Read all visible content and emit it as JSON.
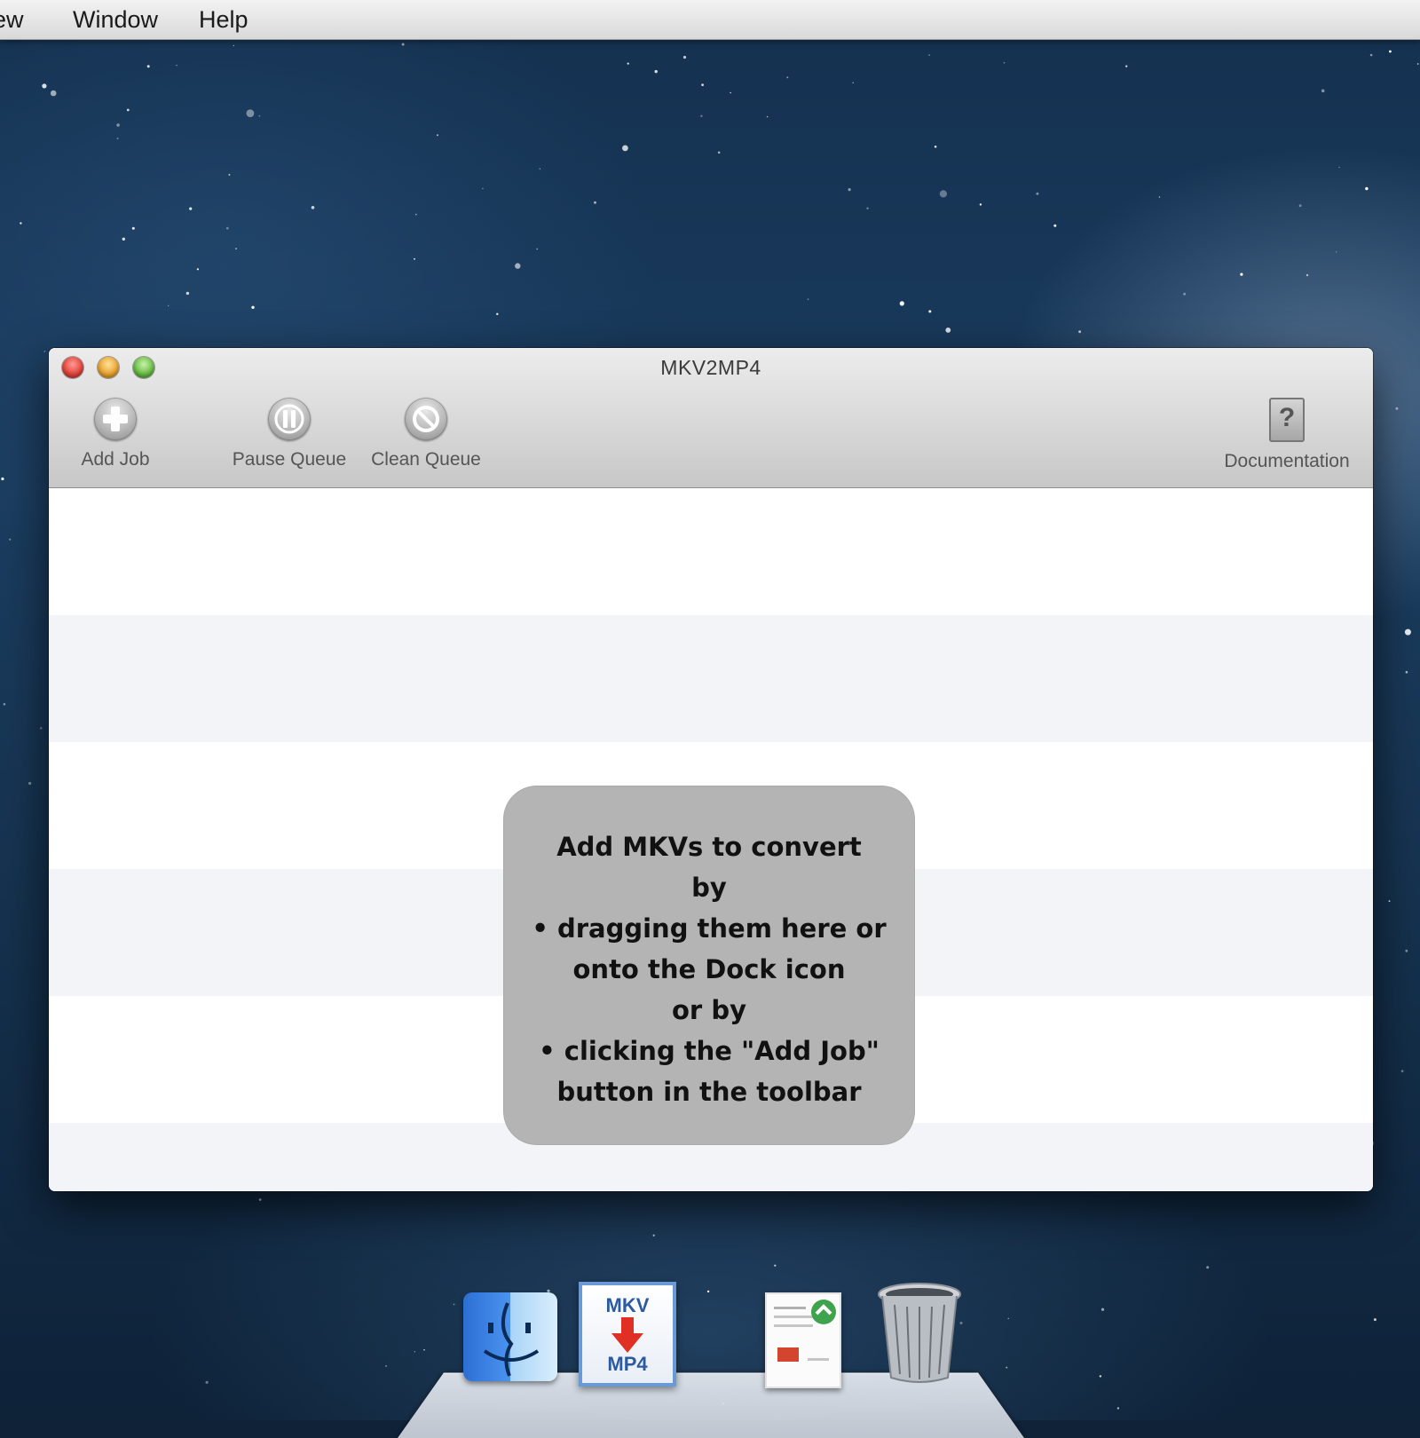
{
  "menubar": {
    "items": [
      "iew",
      "Window",
      "Help"
    ]
  },
  "window": {
    "title": "MKV2MP4",
    "toolbar": {
      "add_job": "Add Job",
      "pause_queue": "Pause Queue",
      "clean_queue": "Clean Queue",
      "documentation": "Documentation"
    },
    "hint": "Add MKVs to convert\nby\n• dragging them here or\nonto the Dock icon\nor by\n• clicking the \"Add Job\"\nbutton in the toolbar"
  },
  "dock": {
    "mkv_icon_top": "MKV",
    "mkv_icon_bottom": "MP4",
    "items": [
      "finder-icon",
      "mkv2mp4-icon",
      "preview-document-icon",
      "trash-icon"
    ]
  },
  "colors": {
    "close": "#e2463e",
    "minimize": "#e9a533",
    "zoom": "#6cbd48",
    "hint_box": "#b4b4b4",
    "stripe": "#f2f4f8"
  }
}
